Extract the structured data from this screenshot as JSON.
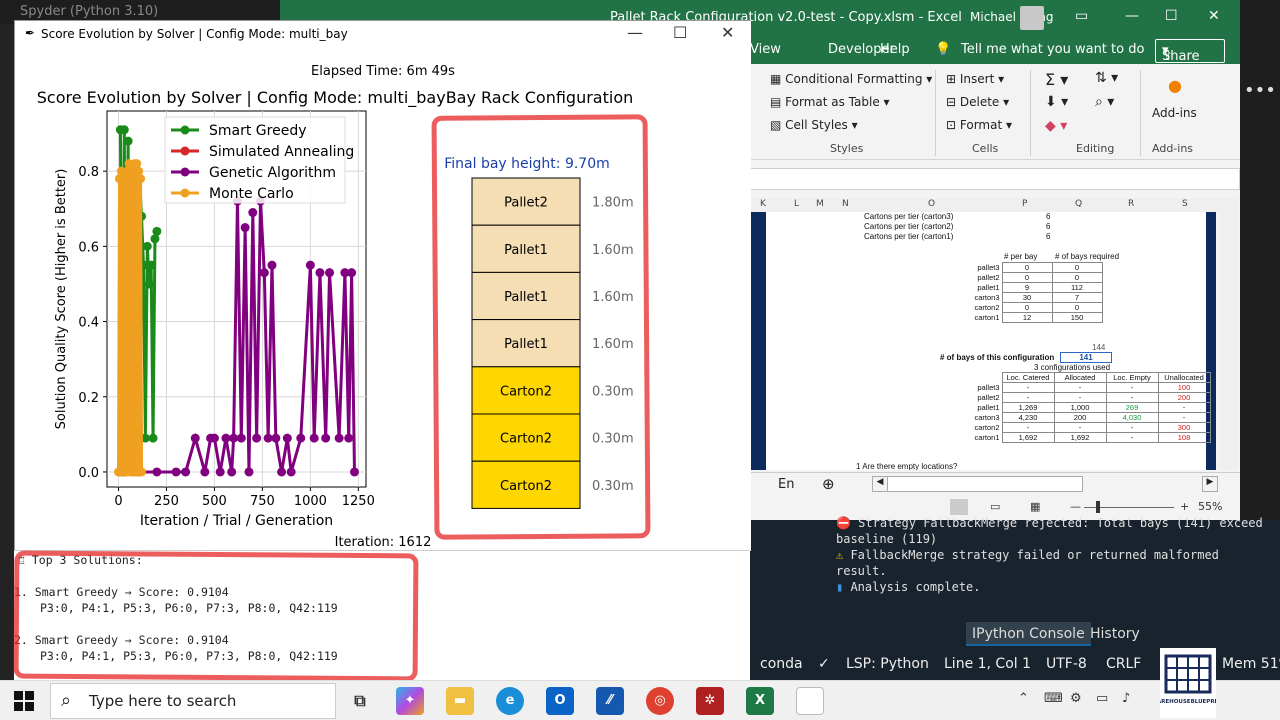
{
  "spyder": {
    "title": "Spyder (Python 3.10)",
    "console_lines": [
      "Strategy FallbackMerge rejected: Total bays (141) exceed",
      "baseline (119)",
      "FallbackMerge strategy failed or returned malformed",
      "result.",
      "Analysis complete."
    ],
    "tabs": {
      "ipython": "IPython Console",
      "history": "History"
    },
    "status": {
      "env": "conda",
      "lsp": "LSP: Python",
      "pos": "Line 1, Col 1",
      "enc": "UTF-8",
      "eol": "CRLF",
      "mem": "Mem 51%"
    }
  },
  "excel": {
    "file_title": "Pallet Rack Configuration v2.0-test - Copy.xlsm - Excel",
    "user": "Michael Wong",
    "menu": {
      "view": "View",
      "developer": "Developer",
      "help": "Help",
      "tellme": "Tell me what you want to do",
      "share": "Share"
    },
    "ribbon": {
      "cond_format": "Conditional Formatting",
      "format_table": "Format as Table",
      "cell_styles": "Cell Styles",
      "styles": "Styles",
      "insert": "Insert",
      "delete": "Delete",
      "format": "Format",
      "cells": "Cells",
      "editing": "Editing",
      "addins": "Add-ins",
      "addins_group": "Add-ins"
    },
    "col_headers": [
      "K",
      "L",
      "M",
      "N",
      "O",
      "P",
      "Q",
      "R",
      "S"
    ],
    "cartons_per_tier": [
      {
        "label": "Cartons per tier (carton3)",
        "value": "6"
      },
      {
        "label": "Cartons per tier (carton2)",
        "value": "6"
      },
      {
        "label": "Cartons per tier (carton1)",
        "value": "6"
      }
    ],
    "per_bay_headers": [
      "# per bay",
      "# of bays required"
    ],
    "per_bay_rows": [
      [
        "pallet3",
        "0",
        "0"
      ],
      [
        "pallet2",
        "0",
        "0"
      ],
      [
        "pallet1",
        "9",
        "112"
      ],
      [
        "carton3",
        "30",
        "7"
      ],
      [
        "carton2",
        "0",
        "0"
      ],
      [
        "carton1",
        "12",
        "150"
      ]
    ],
    "bays_144": "144",
    "bays_label": "# of bays of this configuration",
    "bays_value": "141",
    "configs_used": "3 configurations used",
    "loc_headers": [
      "Loc. Catered",
      "Allocated",
      "Loc. Empty",
      "Unallocated"
    ],
    "loc_rows": [
      [
        "pallet3",
        "-",
        "-",
        "-",
        "100"
      ],
      [
        "pallet2",
        "-",
        "-",
        "-",
        "200"
      ],
      [
        "pallet1",
        "1,269",
        "1,000",
        "269",
        "-"
      ],
      [
        "carton3",
        "4,230",
        "200",
        "4,030",
        "-"
      ],
      [
        "carton2",
        "-",
        "-",
        "-",
        "300"
      ],
      [
        "carton1",
        "1,692",
        "1,692",
        "-",
        "108"
      ]
    ],
    "question": "1  Are there empty locations?",
    "sheet_tab": "En",
    "zoom": "55%"
  },
  "plot_window": {
    "title": "Score Evolution by Solver | Config Mode: multi_bay",
    "elapsed": "Elapsed Time: 6m 49s",
    "suptitle": "Score Evolution by Solver | Config Mode: multi_bayBay Rack Configuration",
    "iteration": "Iteration: 1612"
  },
  "chart_data": [
    {
      "type": "line",
      "title": "Score Evolution by Solver | Config Mode: multi_bay",
      "xlabel": "Iteration / Trial / Generation",
      "ylabel": "Solution Quality Score (Higher is Better)",
      "xlim": [
        -60,
        1290
      ],
      "ylim": [
        -0.04,
        0.96
      ],
      "xticks": [
        0,
        250,
        500,
        750,
        1000,
        1250
      ],
      "yticks": [
        0.0,
        0.2,
        0.4,
        0.6,
        0.8
      ],
      "grid": true,
      "legend_position": "top-right",
      "series": [
        {
          "name": "Smart Greedy",
          "color": "#1a8a1a",
          "x": [
            10,
            20,
            30,
            40,
            50,
            55,
            60,
            65,
            70,
            80,
            90,
            100,
            110,
            120,
            130,
            140,
            150,
            160,
            170,
            180,
            190,
            200
          ],
          "y": [
            0.91,
            0.0,
            0.91,
            0.05,
            0.88,
            0.1,
            0.8,
            0.05,
            0.75,
            0.6,
            0.65,
            0.09,
            0.78,
            0.68,
            0.55,
            0.09,
            0.6,
            0.5,
            0.55,
            0.09,
            0.62,
            0.64
          ]
        },
        {
          "name": "Simulated Annealing",
          "color": "#d62728",
          "x": [
            5,
            15,
            25
          ],
          "y": [
            0.0,
            0.01,
            0.0
          ]
        },
        {
          "name": "Genetic Algorithm",
          "color": "#800080",
          "x": [
            30,
            100,
            200,
            300,
            350,
            400,
            450,
            480,
            500,
            530,
            560,
            590,
            600,
            620,
            640,
            660,
            680,
            700,
            720,
            740,
            760,
            780,
            800,
            820,
            850,
            880,
            900,
            950,
            1000,
            1020,
            1050,
            1080,
            1100,
            1150,
            1180,
            1200,
            1215,
            1230
          ],
          "y": [
            0.0,
            0.0,
            0.0,
            0.0,
            0.0,
            0.09,
            0.0,
            0.09,
            0.09,
            0.0,
            0.09,
            0.0,
            0.09,
            0.72,
            0.09,
            0.65,
            0.0,
            0.69,
            0.09,
            0.72,
            0.53,
            0.09,
            0.55,
            0.09,
            0.0,
            0.09,
            0.0,
            0.09,
            0.55,
            0.09,
            0.53,
            0.09,
            0.53,
            0.09,
            0.53,
            0.09,
            0.53,
            0.0
          ]
        },
        {
          "name": "Monte Carlo",
          "color": "#f0a020",
          "x": [
            0,
            5,
            10,
            15,
            20,
            25,
            30,
            35,
            40,
            45,
            50,
            55,
            60,
            65,
            70,
            75,
            80,
            85,
            90,
            95,
            100,
            105,
            110,
            115,
            120
          ],
          "y": [
            0.0,
            0.78,
            0.0,
            0.8,
            0.02,
            0.77,
            0.0,
            0.79,
            0.0,
            0.8,
            0.01,
            0.82,
            0.0,
            0.78,
            0.0,
            0.8,
            0.0,
            0.82,
            0.0,
            0.82,
            0.0,
            0.8,
            0.0,
            0.78,
            0.0
          ]
        }
      ]
    },
    {
      "type": "bar",
      "title": "Bay Rack Configuration",
      "subtitle": "Final bay height: 9.70m",
      "stack_order": "top-to-bottom",
      "levels": [
        {
          "label": "Pallet2",
          "height": 1.8,
          "height_label": "1.80m",
          "color": "#f5deb3"
        },
        {
          "label": "Pallet1",
          "height": 1.6,
          "height_label": "1.60m",
          "color": "#f5deb3"
        },
        {
          "label": "Pallet1",
          "height": 1.6,
          "height_label": "1.60m",
          "color": "#f5deb3"
        },
        {
          "label": "Pallet1",
          "height": 1.6,
          "height_label": "1.60m",
          "color": "#f5deb3"
        },
        {
          "label": "Carton2",
          "height": 0.3,
          "height_label": "0.30m",
          "color": "#ffd700"
        },
        {
          "label": "Carton2",
          "height": 0.3,
          "height_label": "0.30m",
          "color": "#ffd700"
        },
        {
          "label": "Carton2",
          "height": 0.3,
          "height_label": "0.30m",
          "color": "#ffd700"
        }
      ]
    }
  ],
  "top_solutions": {
    "header": "Top 3 Solutions:",
    "items": [
      {
        "num": "1.",
        "line1": "Smart Greedy → Score: 0.9104",
        "line2": "P3:0, P4:1, P5:3, P6:0, P7:3, P8:0, Q42:119"
      },
      {
        "num": "2.",
        "line1": "Smart Greedy → Score: 0.9104",
        "line2": "P3:0, P4:1, P5:3, P6:0, P7:3, P8:0, Q42:119"
      }
    ]
  },
  "taskbar": {
    "search_placeholder": "Type here to search"
  }
}
